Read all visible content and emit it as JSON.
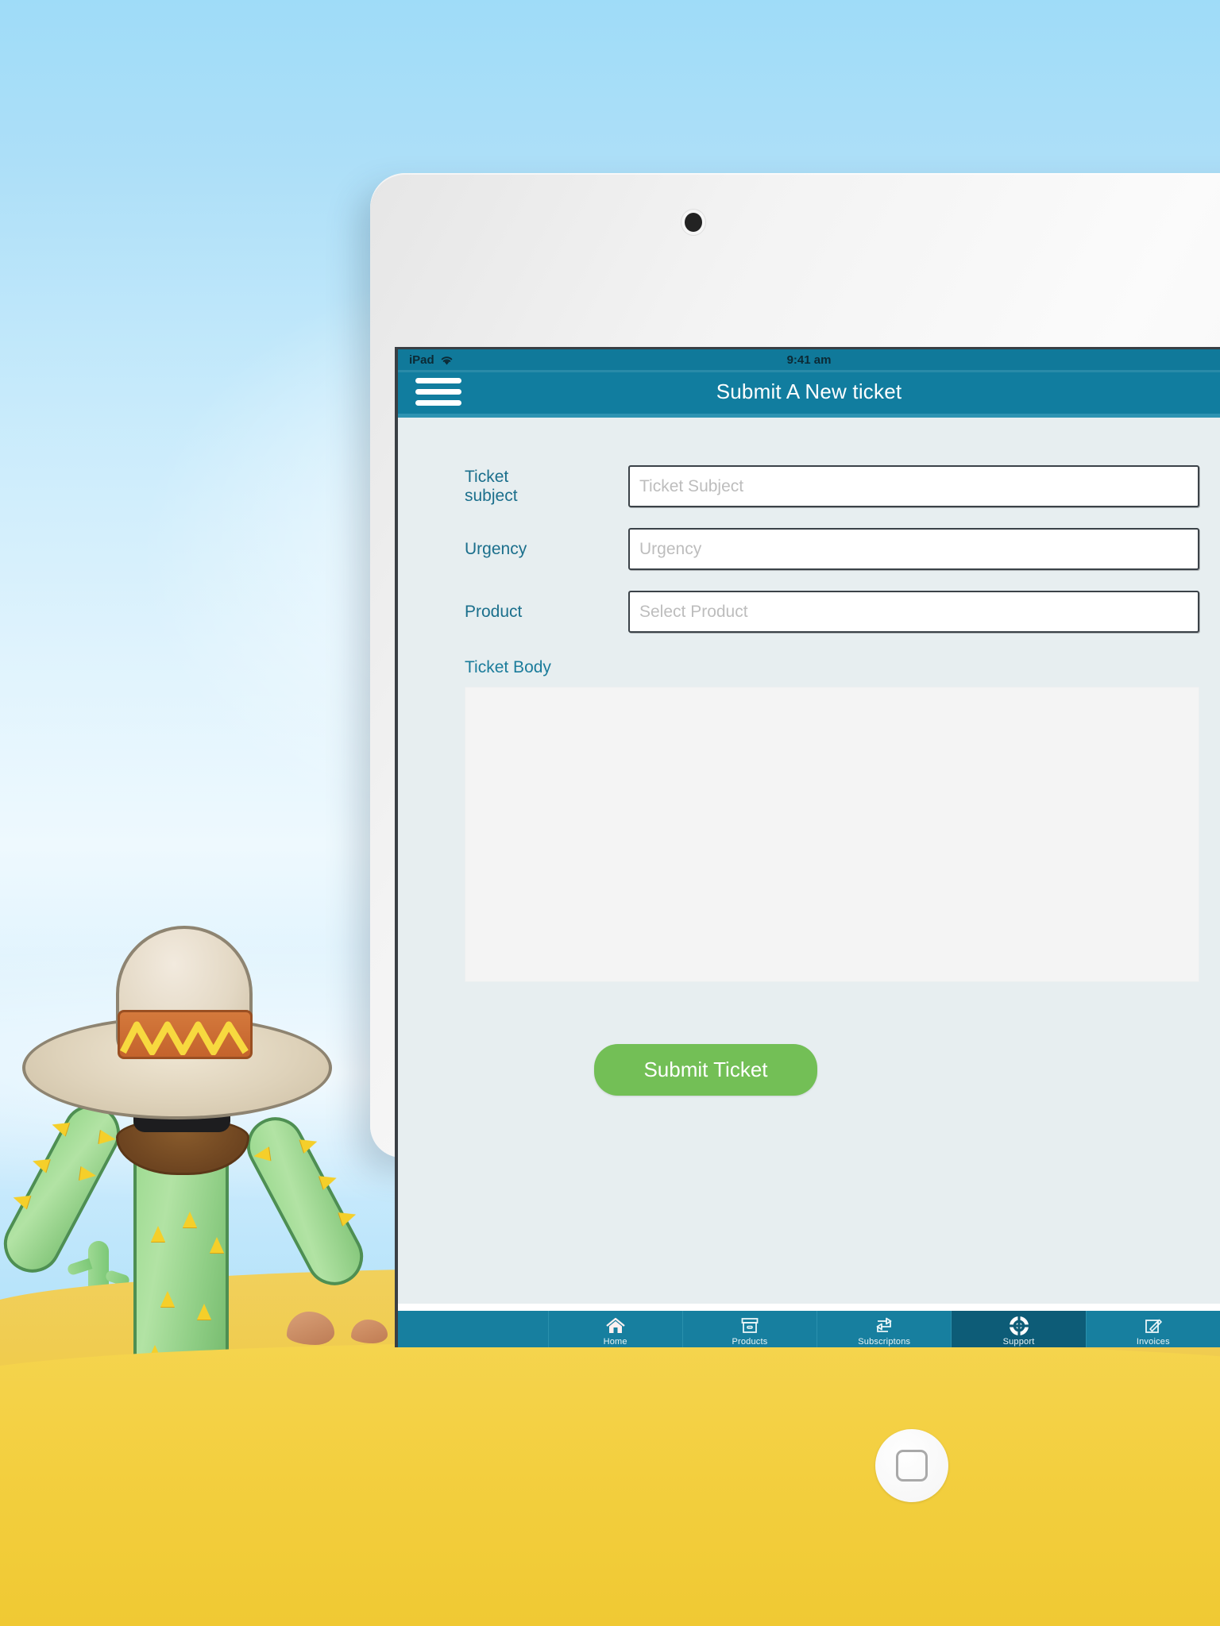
{
  "scene": {
    "description": "desert-background",
    "mascot": "sombrero-cactus-mascot",
    "sky_color": "#a9dff9",
    "sand_color": "#f3cf3f"
  },
  "device": {
    "name": "ipad-tablet",
    "camera": "front-camera",
    "home_button": "home-button"
  },
  "status_bar": {
    "carrier": "iPad",
    "wifi_icon": "wifi-icon",
    "time": "9:41 am"
  },
  "navbar": {
    "menu_icon": "hamburger-menu-icon",
    "title": "Submit A New ticket",
    "background": "#117d9f"
  },
  "form": {
    "fields": [
      {
        "label": "Ticket subject",
        "placeholder": "Ticket Subject",
        "value": "",
        "name": "ticket-subject"
      },
      {
        "label": "Urgency",
        "placeholder": "Urgency",
        "value": "",
        "name": "urgency"
      },
      {
        "label": "Product",
        "placeholder": "Select Product",
        "value": "",
        "name": "product"
      }
    ],
    "body_label": "Ticket Body",
    "body_value": "",
    "submit_label": "Submit Ticket",
    "submit_color": "#73bf56",
    "label_color": "#1b6f8c"
  },
  "tabbar": {
    "active": "Support",
    "items": [
      {
        "label": "Home",
        "icon": "home-icon"
      },
      {
        "label": "Products",
        "icon": "box-icon"
      },
      {
        "label": "Subscriptons",
        "icon": "recycle-arrows-icon"
      },
      {
        "label": "Support",
        "icon": "lifebuoy-icon"
      },
      {
        "label": "Invoices",
        "icon": "edit-pencil-icon"
      }
    ]
  }
}
